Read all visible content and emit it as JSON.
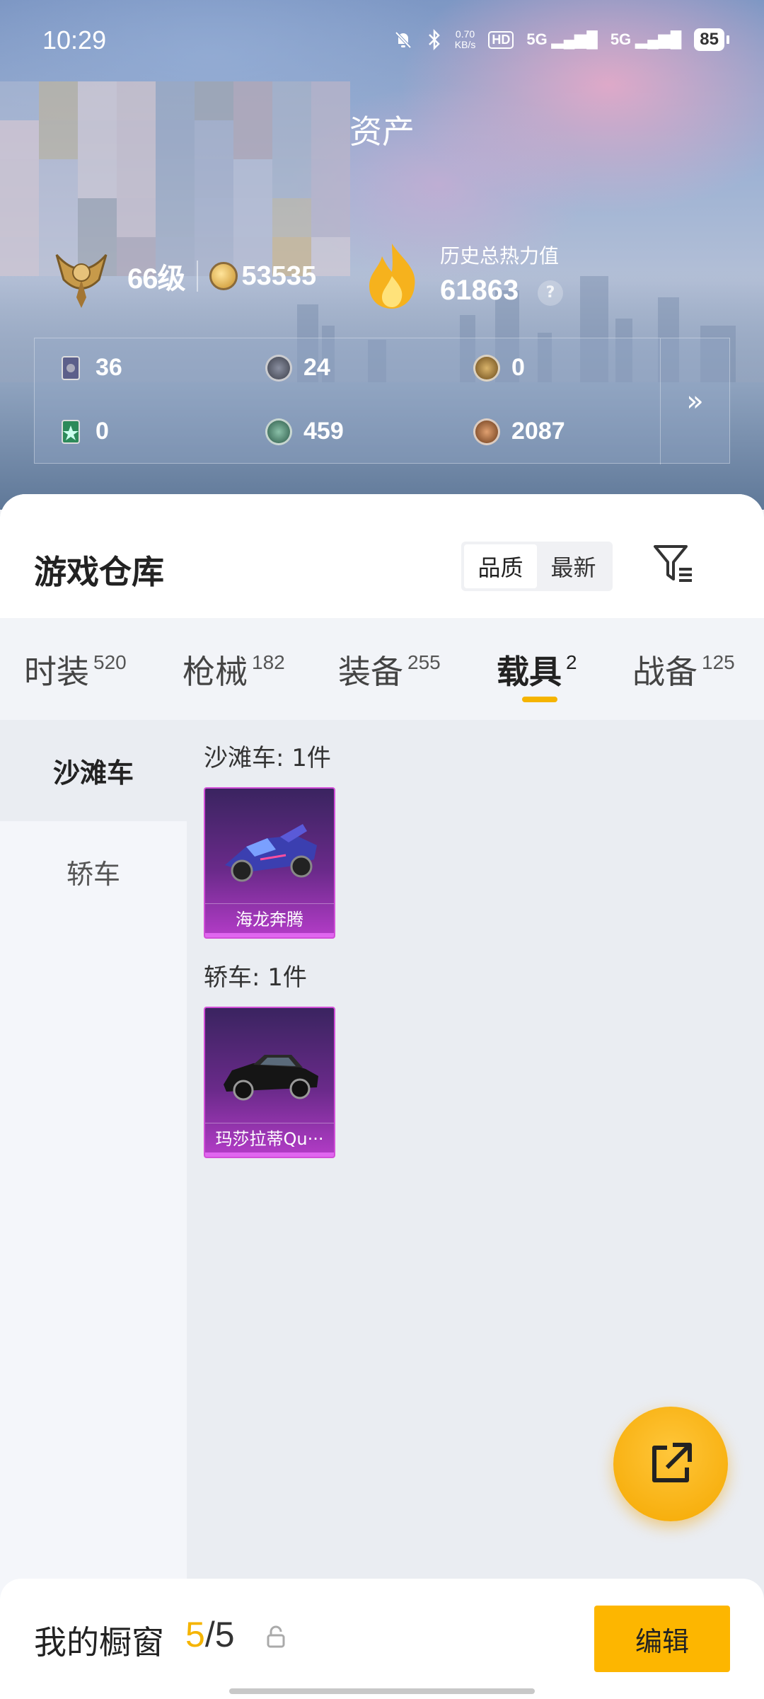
{
  "status_bar": {
    "time": "10:29",
    "net_speed_value": "0.70",
    "net_speed_unit": "KB/s",
    "hd_label": "HD",
    "signal1": "5G",
    "signal2": "5G",
    "battery": "85"
  },
  "header": {
    "title": "资产",
    "level": "66级",
    "coins": "53535",
    "heat_label": "历史总热力值",
    "heat_value": "61863",
    "help": "?"
  },
  "currencies": [
    {
      "value": "36",
      "icon": "card-icon"
    },
    {
      "value": "24",
      "icon": "dark-coin-icon"
    },
    {
      "value": "0",
      "icon": "gold-medal-icon"
    },
    {
      "value": "0",
      "icon": "green-card-icon"
    },
    {
      "value": "459",
      "icon": "green-coin-icon"
    },
    {
      "value": "2087",
      "icon": "bronze-coin-icon"
    }
  ],
  "more_glyph": "»",
  "warehouse": {
    "title": "游戏仓库",
    "sort_options": [
      "品质",
      "最新"
    ],
    "sort_selected": "品质"
  },
  "tabs": [
    {
      "label": "时装",
      "count": "520",
      "active": false
    },
    {
      "label": "枪械",
      "count": "182",
      "active": false
    },
    {
      "label": "装备",
      "count": "255",
      "active": false
    },
    {
      "label": "载具",
      "count": "2",
      "active": true
    },
    {
      "label": "战备",
      "count": "125",
      "active": false
    }
  ],
  "sidebar": {
    "items": [
      {
        "label": "沙滩车",
        "active": true
      },
      {
        "label": "轿车",
        "active": false
      }
    ]
  },
  "groups": [
    {
      "title": "沙滩车: 1件",
      "items": [
        {
          "name": "海龙奔腾"
        }
      ]
    },
    {
      "title": "轿车: 1件",
      "items": [
        {
          "name": "玛莎拉蒂Qu···"
        }
      ]
    }
  ],
  "showcase": {
    "label": "我的橱窗",
    "current": "5",
    "separator": "/",
    "max": "5",
    "edit_label": "编辑"
  },
  "colors": {
    "accent": "#f5b400",
    "card_purple": "#b43cc8"
  }
}
